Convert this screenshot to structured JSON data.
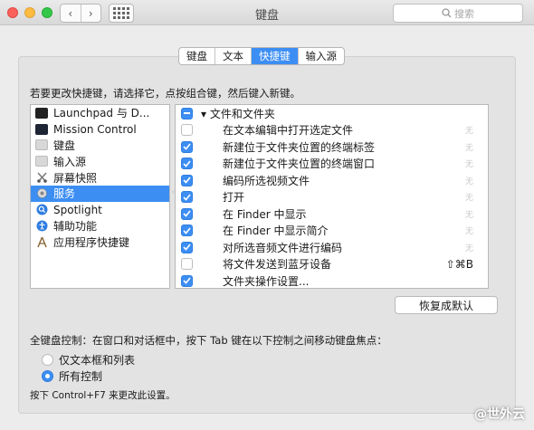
{
  "window": {
    "title": "键盘"
  },
  "search": {
    "placeholder": "搜索"
  },
  "nav": {
    "back": "‹",
    "forward": "›"
  },
  "tabs": [
    {
      "label": "键盘",
      "active": false
    },
    {
      "label": "文本",
      "active": false
    },
    {
      "label": "快捷键",
      "active": true
    },
    {
      "label": "输入源",
      "active": false
    }
  ],
  "instruction": "若要更改快捷键，请选择它，点按组合键，然后键入新键。",
  "categories": [
    {
      "label": "Launchpad 与 D...",
      "icon": "launchpad-icon",
      "selected": false
    },
    {
      "label": "Mission Control",
      "icon": "mission-control-icon",
      "selected": false
    },
    {
      "label": "键盘",
      "icon": "keyboard-icon",
      "selected": false
    },
    {
      "label": "输入源",
      "icon": "input-source-icon",
      "selected": false
    },
    {
      "label": "屏幕快照",
      "icon": "screenshot-icon",
      "selected": false
    },
    {
      "label": "服务",
      "icon": "services-gear-icon",
      "selected": true
    },
    {
      "label": "Spotlight",
      "icon": "spotlight-icon",
      "selected": false
    },
    {
      "label": "辅助功能",
      "icon": "accessibility-icon",
      "selected": false
    },
    {
      "label": "应用程序快捷键",
      "icon": "app-shortcuts-icon",
      "selected": false
    }
  ],
  "shortcuts": {
    "group": {
      "label": "文件和文件夹",
      "state": "mixed"
    },
    "items": [
      {
        "label": "在文本编辑中打开选定文件",
        "checked": false,
        "shortcut": "无"
      },
      {
        "label": "新建位于文件夹位置的终端标签",
        "checked": true,
        "shortcut": "无"
      },
      {
        "label": "新建位于文件夹位置的终端窗口",
        "checked": true,
        "shortcut": "无"
      },
      {
        "label": "编码所选视频文件",
        "checked": true,
        "shortcut": "无"
      },
      {
        "label": "打开",
        "checked": true,
        "shortcut": "无"
      },
      {
        "label": "在 Finder 中显示",
        "checked": true,
        "shortcut": "无"
      },
      {
        "label": "在 Finder 中显示简介",
        "checked": true,
        "shortcut": "无"
      },
      {
        "label": "对所选音频文件进行编码",
        "checked": true,
        "shortcut": "无"
      },
      {
        "label": "将文件发送到蓝牙设备",
        "checked": false,
        "shortcut": "⇧⌘B"
      },
      {
        "label": "文件夹操作设置...",
        "checked": true,
        "shortcut": ""
      }
    ]
  },
  "reset_button": "恢复成默认",
  "full_keyboard": {
    "label": "全键盘控制：在窗口和对话框中，按下 Tab 键在以下控制之间移动键盘焦点：",
    "options": [
      {
        "label": "仅文本框和列表",
        "selected": false
      },
      {
        "label": "所有控制",
        "selected": true
      }
    ],
    "hint": "按下 Control+F7 来更改此设置。"
  },
  "watermark": "@世外云",
  "colors": {
    "accent": "#3c8ef3"
  }
}
